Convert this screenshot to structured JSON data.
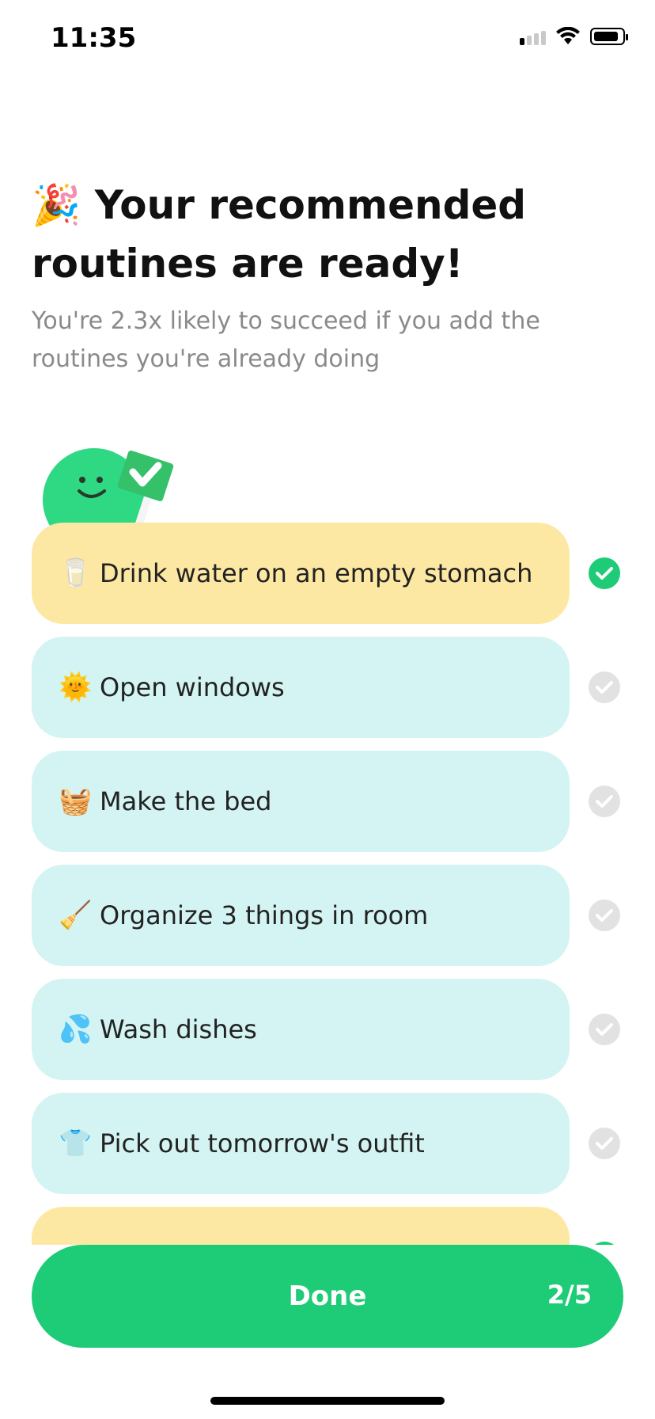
{
  "status_bar": {
    "time": "11:35"
  },
  "header": {
    "emoji": "🎉",
    "title": "Your recommended routines are ready!",
    "subtitle": "You're 2.3x likely to succeed if you add the routines you're already doing"
  },
  "routines": [
    {
      "emoji": "🥛",
      "label": "Drink water on an empty stomach",
      "selected": true
    },
    {
      "emoji": "🌞",
      "label": "Open windows",
      "selected": false
    },
    {
      "emoji": "🧺",
      "label": "Make the bed",
      "selected": false
    },
    {
      "emoji": "🧹",
      "label": "Organize 3 things in room",
      "selected": false
    },
    {
      "emoji": "💦",
      "label": "Wash dishes",
      "selected": false
    },
    {
      "emoji": "👕",
      "label": "Pick out tomorrow's outfit",
      "selected": false
    },
    {
      "emoji": "",
      "label": "",
      "selected": true
    }
  ],
  "done_button": {
    "label": "Done",
    "progress": "2/5"
  },
  "colors": {
    "accent_green": "#1ecb76",
    "selected_card": "#fde8a3",
    "unselected_card": "#d3f4f2",
    "check_off": "#e2e2e2"
  }
}
